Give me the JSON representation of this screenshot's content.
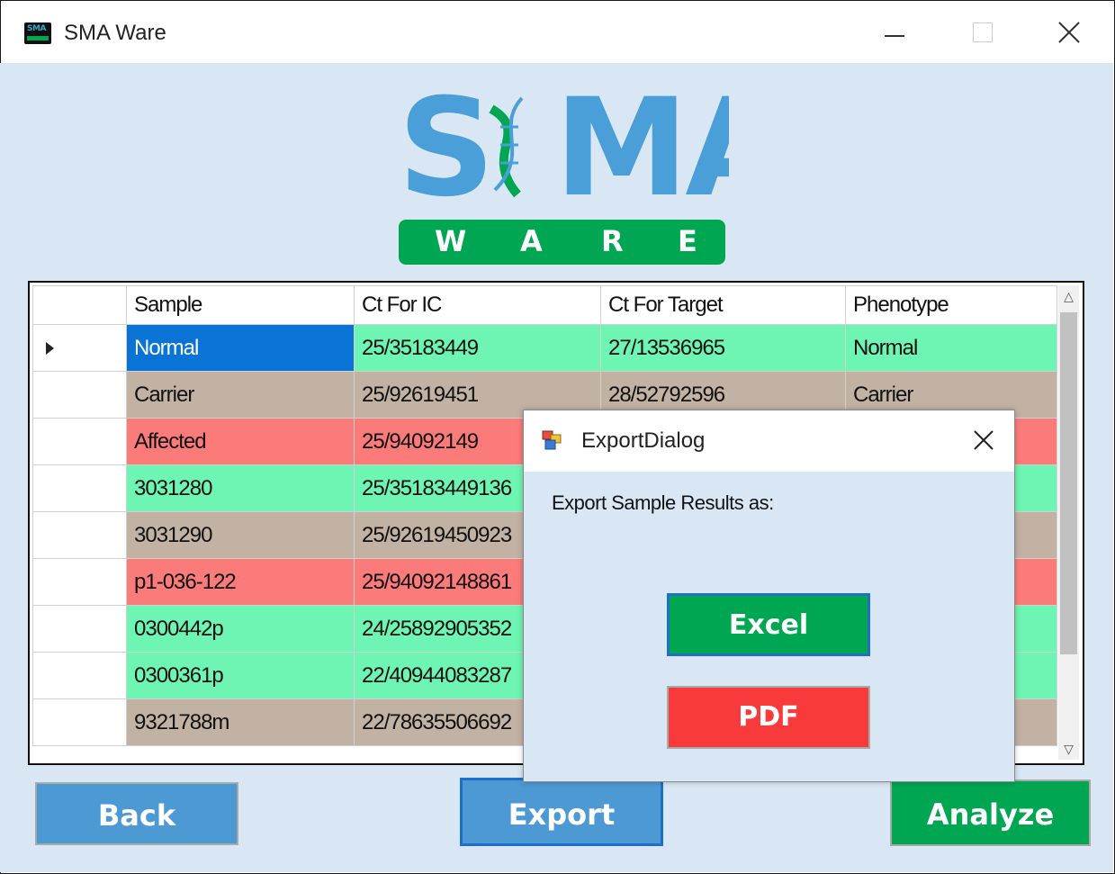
{
  "window": {
    "title": "SMA Ware",
    "icon_text": "SMA",
    "icon_name": "sma-ware-app-icon"
  },
  "logo": {
    "word": "SMA",
    "banner_letters": [
      "W",
      "A",
      "R",
      "E"
    ],
    "colors": {
      "blue": "#4a9fd8",
      "green": "#00a651"
    }
  },
  "grid": {
    "columns": [
      "Sample",
      "Ct For IC",
      "Ct For Target",
      "Phenotype"
    ],
    "rows": [
      {
        "status": "normal",
        "selected": true,
        "cells": [
          "Normal",
          "25/35183449",
          "27/13536965",
          "Normal"
        ]
      },
      {
        "status": "carrier",
        "selected": false,
        "cells": [
          "Carrier",
          "25/92619451",
          "28/52792596",
          "Carrier"
        ]
      },
      {
        "status": "affected",
        "selected": false,
        "cells": [
          "Affected",
          "25/94092149",
          "",
          ""
        ]
      },
      {
        "status": "normal",
        "selected": false,
        "cells": [
          "3031280",
          "25/35183449136",
          "",
          ""
        ]
      },
      {
        "status": "carrier",
        "selected": false,
        "cells": [
          "3031290",
          "25/92619450923",
          "",
          ""
        ]
      },
      {
        "status": "affected",
        "selected": false,
        "cells": [
          "p1-036-122",
          "25/94092148861",
          "",
          ""
        ]
      },
      {
        "status": "normal",
        "selected": false,
        "cells": [
          "0300442p",
          "24/25892905352",
          "",
          ""
        ]
      },
      {
        "status": "normal",
        "selected": false,
        "cells": [
          "0300361p",
          "22/40944083287",
          "",
          ""
        ]
      },
      {
        "status": "carrier",
        "selected": false,
        "cells": [
          "9321788m",
          "22/78635506692",
          "",
          ""
        ]
      }
    ],
    "status_colors": {
      "normal": "#6ff5b3",
      "carrier": "#c2b2a4",
      "affected": "#fb7b7b",
      "selected": "#0a74d6"
    }
  },
  "buttons": {
    "back": "Back",
    "export": "Export",
    "analyze": "Analyze"
  },
  "dialog": {
    "title": "ExportDialog",
    "prompt": "Export Sample Results as:",
    "excel": "Excel",
    "pdf": "PDF"
  }
}
